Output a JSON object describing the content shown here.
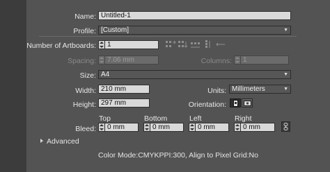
{
  "form": {
    "name_label": "Name:",
    "name_value": "Untitled-1",
    "profile_label": "Profile:",
    "profile_value": "[Custom]",
    "artboards_label": "Number of Artboards:",
    "artboards_value": "1",
    "spacing_label": "Spacing:",
    "spacing_value": "7.06 mm",
    "columns_label": "Columns:",
    "columns_value": "1",
    "size_label": "Size:",
    "size_value": "A4",
    "width_label": "Width:",
    "width_value": "210 mm",
    "units_label": "Units:",
    "units_value": "Millimeters",
    "height_label": "Height:",
    "height_value": "297 mm",
    "orientation_label": "Orientation:",
    "bleed_label": "Bleed:",
    "bleed_top_label": "Top",
    "bleed_bottom_label": "Bottom",
    "bleed_left_label": "Left",
    "bleed_right_label": "Right",
    "bleed_top_value": "0 mm",
    "bleed_bottom_value": "0 mm",
    "bleed_left_value": "0 mm",
    "bleed_right_value": "0 mm",
    "advanced_label": "Advanced",
    "status_line": "Color Mode:CMYKPPI:300, Align to Pixel Grid:No"
  },
  "icons": {
    "artboard_layouts": [
      "grid-by-row-icon",
      "grid-by-column-icon",
      "arrange-by-row-icon",
      "arrange-by-column-icon",
      "rtl-icon"
    ],
    "orientation": [
      "portrait-icon",
      "landscape-icon"
    ],
    "link": "link-icon",
    "disclosure": "disclosure-triangle-icon"
  }
}
